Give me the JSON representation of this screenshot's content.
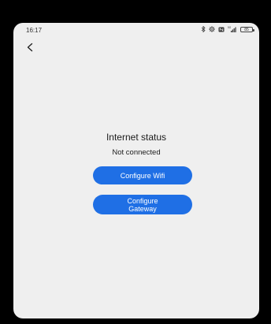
{
  "status_bar": {
    "time": "16:17",
    "battery": "85",
    "icons": [
      "bluetooth-icon",
      "settings-gear-icon",
      "nfc-icon",
      "signal-icon",
      "battery-icon"
    ]
  },
  "nav": {
    "back_glyph": "<"
  },
  "main": {
    "title": "Internet status",
    "status": "Not connected",
    "configure_wifi_label": "Configure Wifi",
    "configure_gateway_label": "Configure Gateway"
  },
  "colors": {
    "primary_button": "#1f6fe5",
    "screen_background": "#efefef"
  }
}
